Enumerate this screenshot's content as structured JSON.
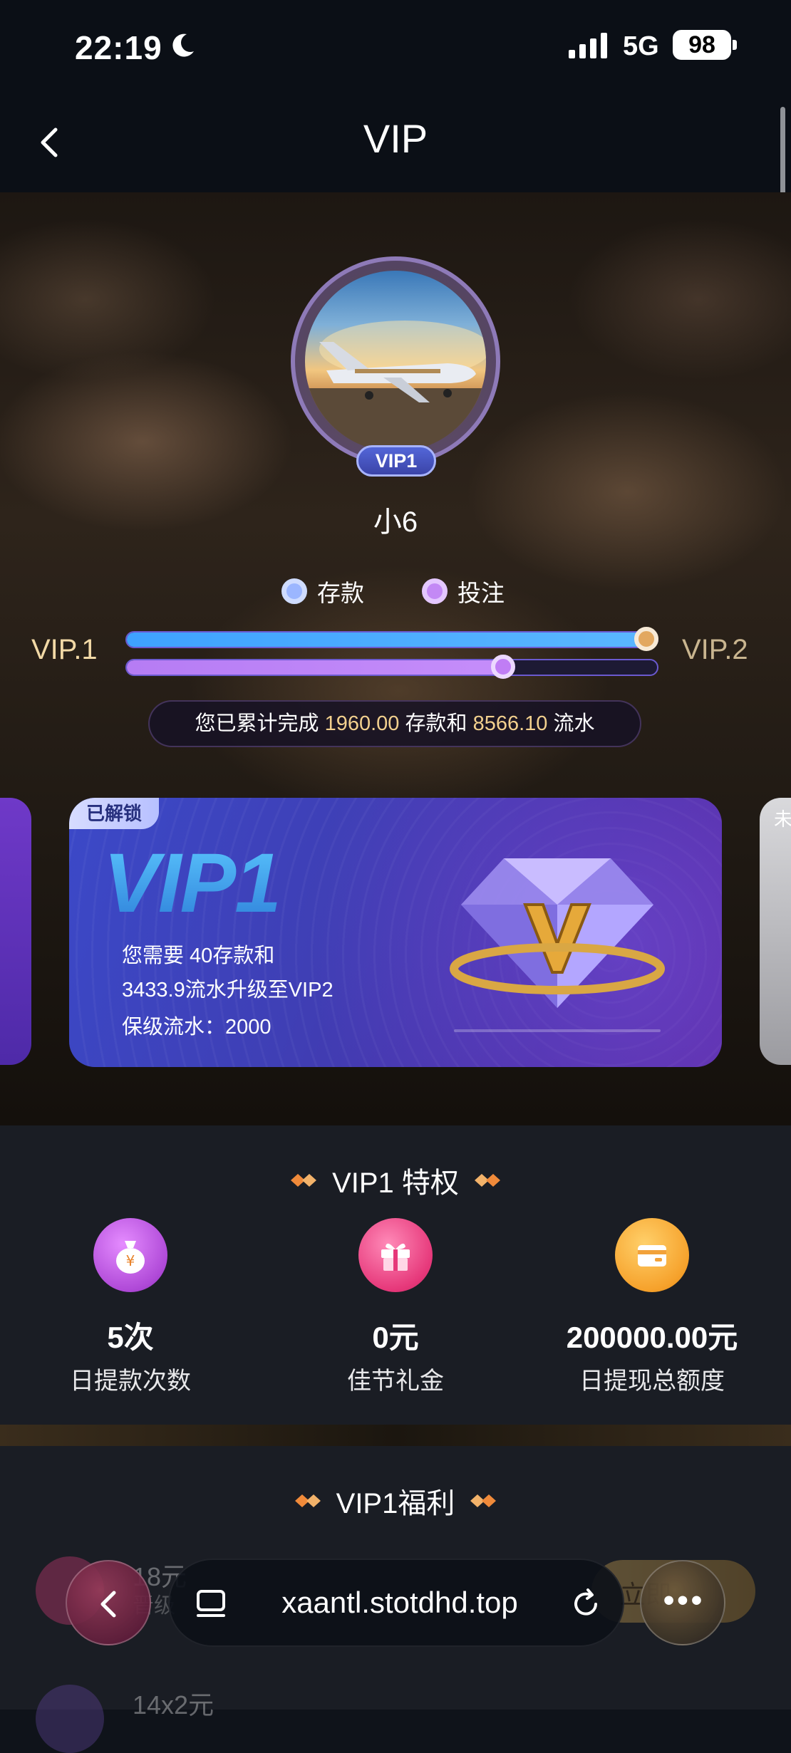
{
  "status_bar": {
    "time": "22:19",
    "network": "5G",
    "battery": "98"
  },
  "nav": {
    "title": "VIP"
  },
  "profile": {
    "badge": "VIP1",
    "username": "小6"
  },
  "legend": {
    "deposit": "存款",
    "bet": "投注"
  },
  "progress": {
    "current_level": "VIP.1",
    "next_level": "VIP.2",
    "deposit_fraction": 0.98,
    "bet_fraction": 0.71,
    "summary_prefix": "您已累计完成",
    "deposit_amount": "1960.00",
    "summary_mid": "存款和",
    "turnover_amount": "8566.10",
    "summary_suffix": "流水"
  },
  "vip_card": {
    "tag": "已解锁",
    "level": "VIP1",
    "line1": "您需要  40存款和",
    "line2": "3433.9流水升级至VIP2",
    "line3": "保级流水：2000"
  },
  "side_card_right": {
    "tag": "未"
  },
  "privileges": {
    "title": "VIP1 特权",
    "items": [
      {
        "value": "5次",
        "label": "日提款次数",
        "icon": "money-bag-icon",
        "color": "#b04ad8"
      },
      {
        "value": "0元",
        "label": "佳节礼金",
        "icon": "gift-icon",
        "color": "#e6387a"
      },
      {
        "value": "200000.00元",
        "label": "日提现总额度",
        "icon": "wallet-card-icon",
        "color": "#f6a22c"
      }
    ]
  },
  "welfare": {
    "title": "VIP1福利",
    "rows": [
      {
        "amount": "18元",
        "sub": "晋级",
        "button": "立即"
      },
      {
        "amount": "14x2元"
      }
    ]
  },
  "browser": {
    "url": "xaantl.stotdhd.top",
    "more": "•••"
  }
}
